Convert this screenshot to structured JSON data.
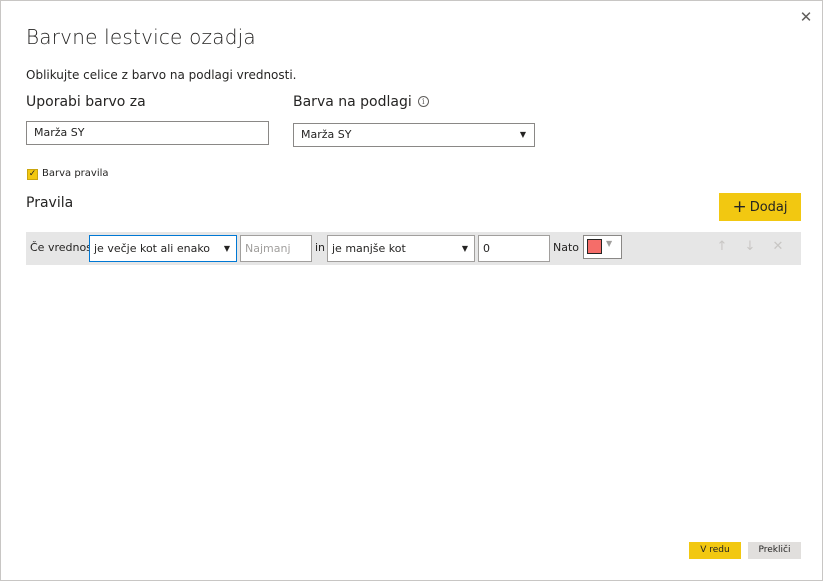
{
  "dialog": {
    "title": "Barvne lestvice ozadja",
    "subtitle": "Oblikujte celice z barvo na podlagi vrednosti.",
    "close_glyph": "✕"
  },
  "apply_color_to": {
    "label": "Uporabi barvo za",
    "value": "Marža SY"
  },
  "based_on": {
    "label": "Barva na podlagi",
    "info_glyph": "i",
    "value": "Marža SY"
  },
  "rule_color_checkbox": {
    "label": "Barva pravila",
    "checked": true
  },
  "rules": {
    "label": "Pravila",
    "add_label": "Dodaj",
    "add_glyph": "+",
    "items": [
      {
        "prefix": "Če vrednost",
        "operator1": "je večje kot ali enako",
        "value1_placeholder": "Najmanj",
        "value1": "",
        "joiner": "in",
        "operator2": "je manjše kot",
        "value2": "0",
        "then_label": "Nato",
        "color": "#f56d69"
      }
    ]
  },
  "footer": {
    "ok_label": "V redu",
    "cancel_label": "Prekliči"
  },
  "colors": {
    "accent": "#f2c811",
    "focus": "#0078d4"
  }
}
